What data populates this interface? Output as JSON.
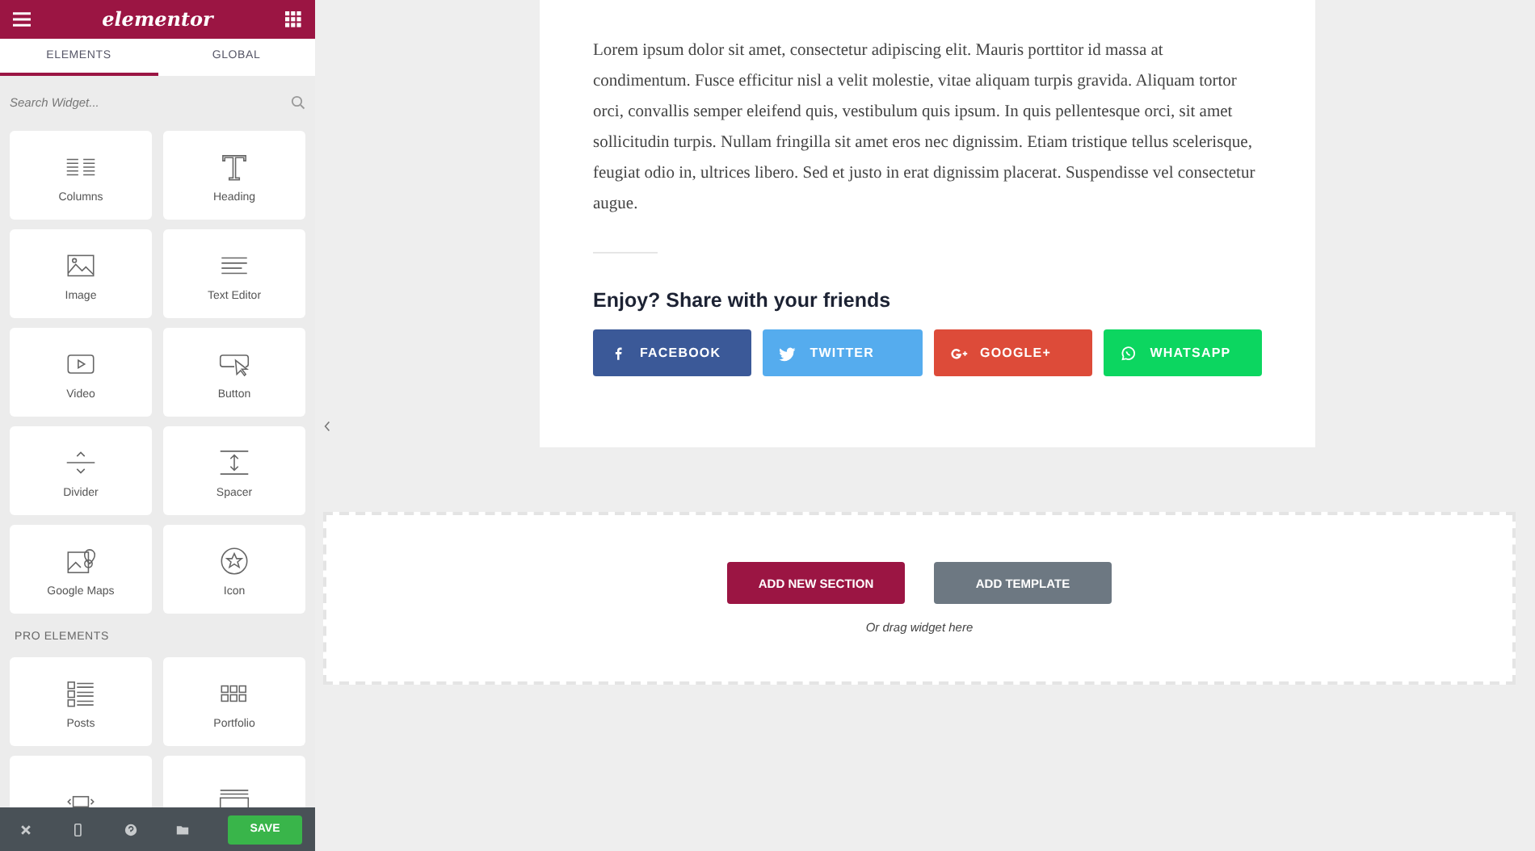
{
  "header": {
    "logo": "elementor"
  },
  "tabs": [
    {
      "label": "ELEMENTS",
      "selected": true
    },
    {
      "label": "GLOBAL",
      "selected": false
    }
  ],
  "search": {
    "placeholder": "Search Widget..."
  },
  "widgets": [
    {
      "kind": "columns",
      "label": "Columns"
    },
    {
      "kind": "heading",
      "label": "Heading"
    },
    {
      "kind": "image",
      "label": "Image"
    },
    {
      "kind": "text",
      "label": "Text Editor"
    },
    {
      "kind": "video",
      "label": "Video"
    },
    {
      "kind": "button",
      "label": "Button"
    },
    {
      "kind": "divider",
      "label": "Divider"
    },
    {
      "kind": "spacer",
      "label": "Spacer"
    },
    {
      "kind": "map",
      "label": "Google Maps"
    },
    {
      "kind": "icon",
      "label": "Icon"
    }
  ],
  "pro_section": {
    "title": "PRO ELEMENTS"
  },
  "pro_widgets": [
    {
      "kind": "posts",
      "label": "Posts"
    },
    {
      "kind": "portfolio",
      "label": "Portfolio"
    },
    {
      "kind": "slides"
    },
    {
      "kind": "form"
    }
  ],
  "footer": {
    "save": "SAVE"
  },
  "article": {
    "paragraph": "Lorem ipsum dolor sit amet, consectetur adipiscing elit. Mauris porttitor id massa at condimentum. Fusce efficitur nisl a velit molestie, vitae aliquam turpis gravida. Aliquam tortor orci, convallis semper eleifend quis, vestibulum quis ipsum. In quis pellentesque orci, sit amet sollicitudin turpis. Nullam fringilla sit amet eros nec dignissim. Etiam tristique tellus scelerisque, feugiat odio in, ultrices libero. Sed et justo in erat dignissim placerat. Suspendisse vel consectetur augue.",
    "share_title": "Enjoy? Share with your friends"
  },
  "share_buttons": [
    {
      "kind": "facebook",
      "label": "FACEBOOK",
      "color": "#3b5998"
    },
    {
      "kind": "twitter",
      "label": "TWITTER",
      "color": "#55acee"
    },
    {
      "kind": "google",
      "label": "GOOGLE+",
      "color": "#dd4b39"
    },
    {
      "kind": "whatsapp",
      "label": "WHATSAPP",
      "color": "#0cd660"
    }
  ],
  "drop_zone": {
    "add_section": "ADD NEW SECTION",
    "add_template": "ADD TEMPLATE",
    "hint": "Or drag widget here"
  }
}
